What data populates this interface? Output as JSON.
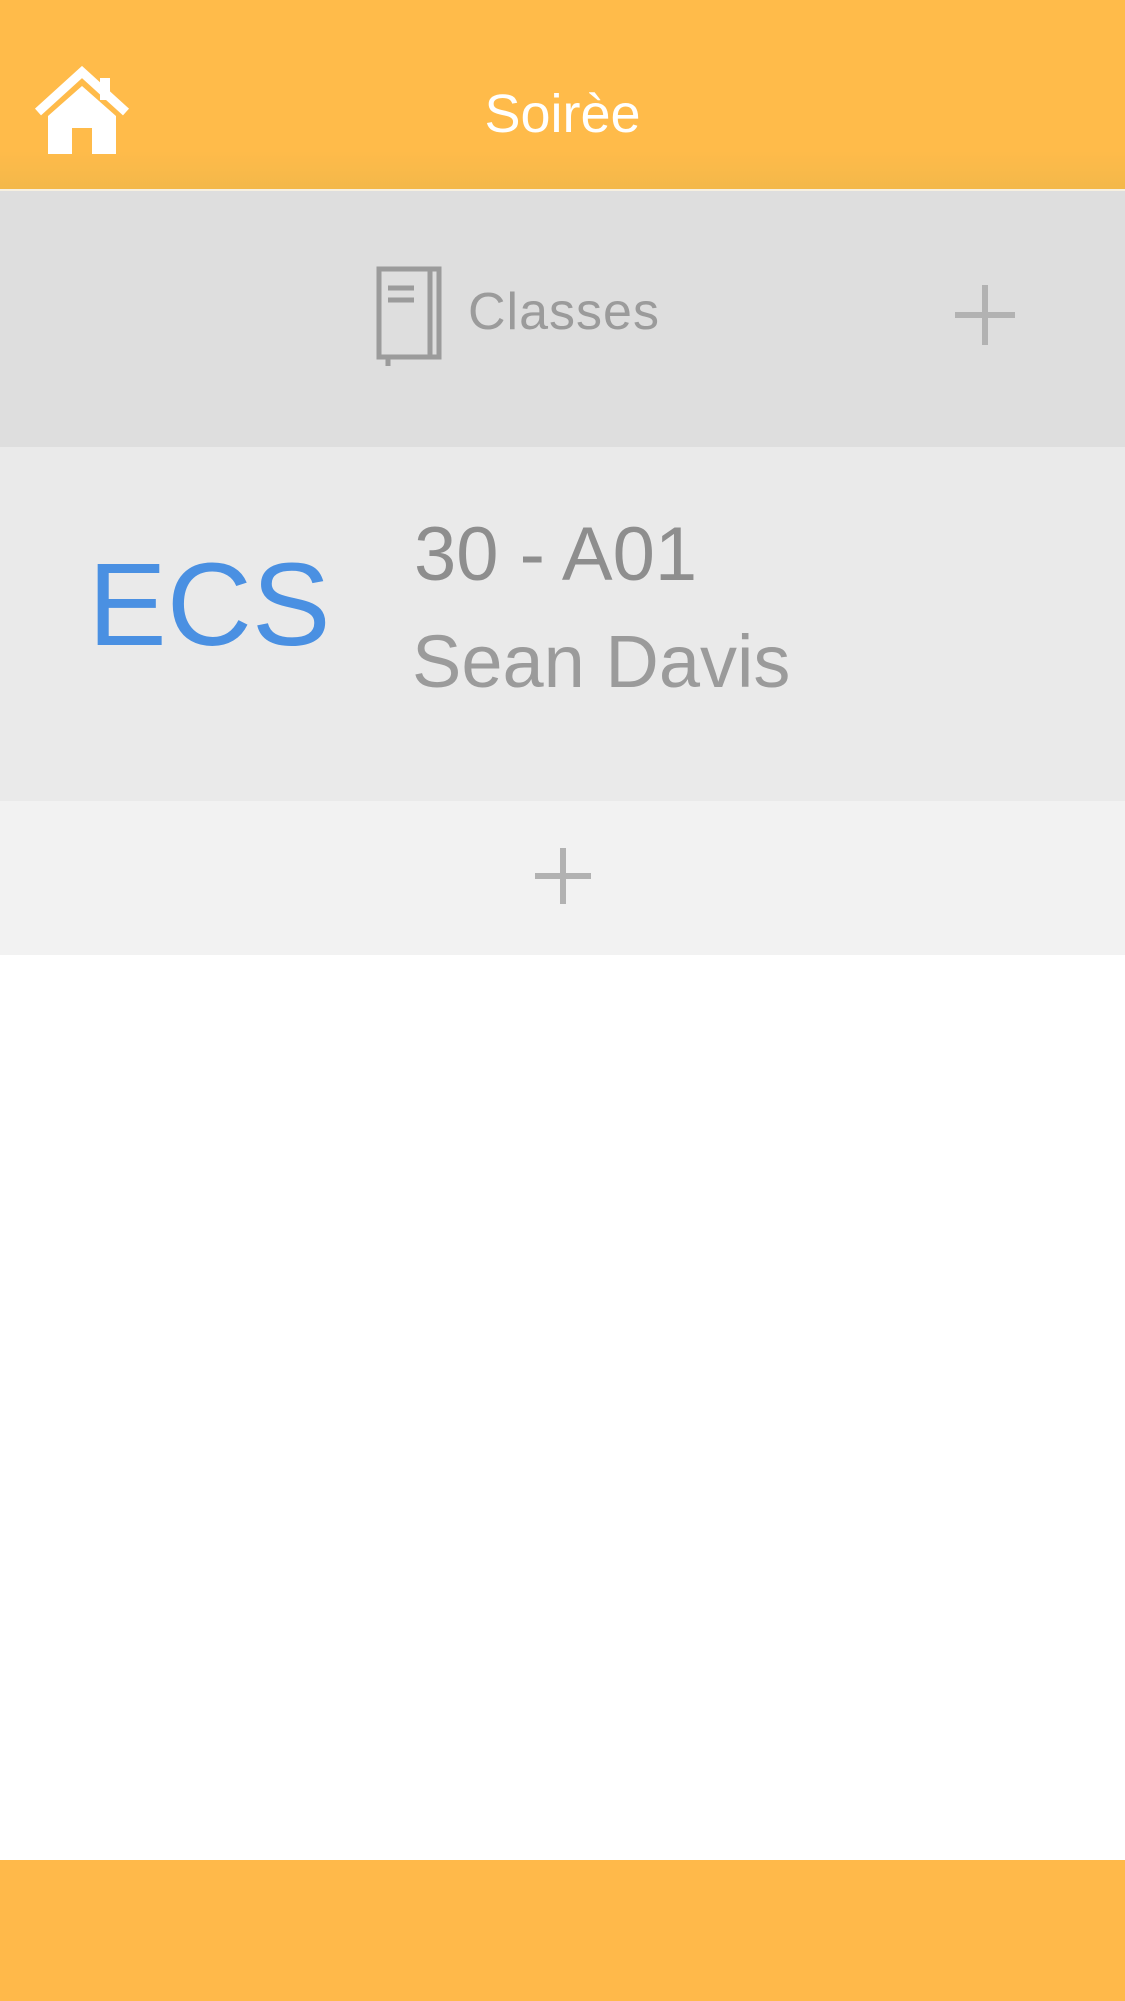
{
  "nav": {
    "title": "Soirèe",
    "home_icon": "home-icon",
    "bar_color": "#ffbb4a"
  },
  "section": {
    "title": "Classes",
    "icon": "book-icon",
    "add_icon": "plus-icon",
    "background": "#dedede"
  },
  "classes": [
    {
      "abbreviation": "ECS",
      "code": "30 - A01",
      "teacher": "Sean Davis",
      "accent": "#4a90e2"
    }
  ],
  "add_row": {
    "icon": "plus-icon"
  },
  "tab_bar": {
    "color": "#ffb94a"
  }
}
